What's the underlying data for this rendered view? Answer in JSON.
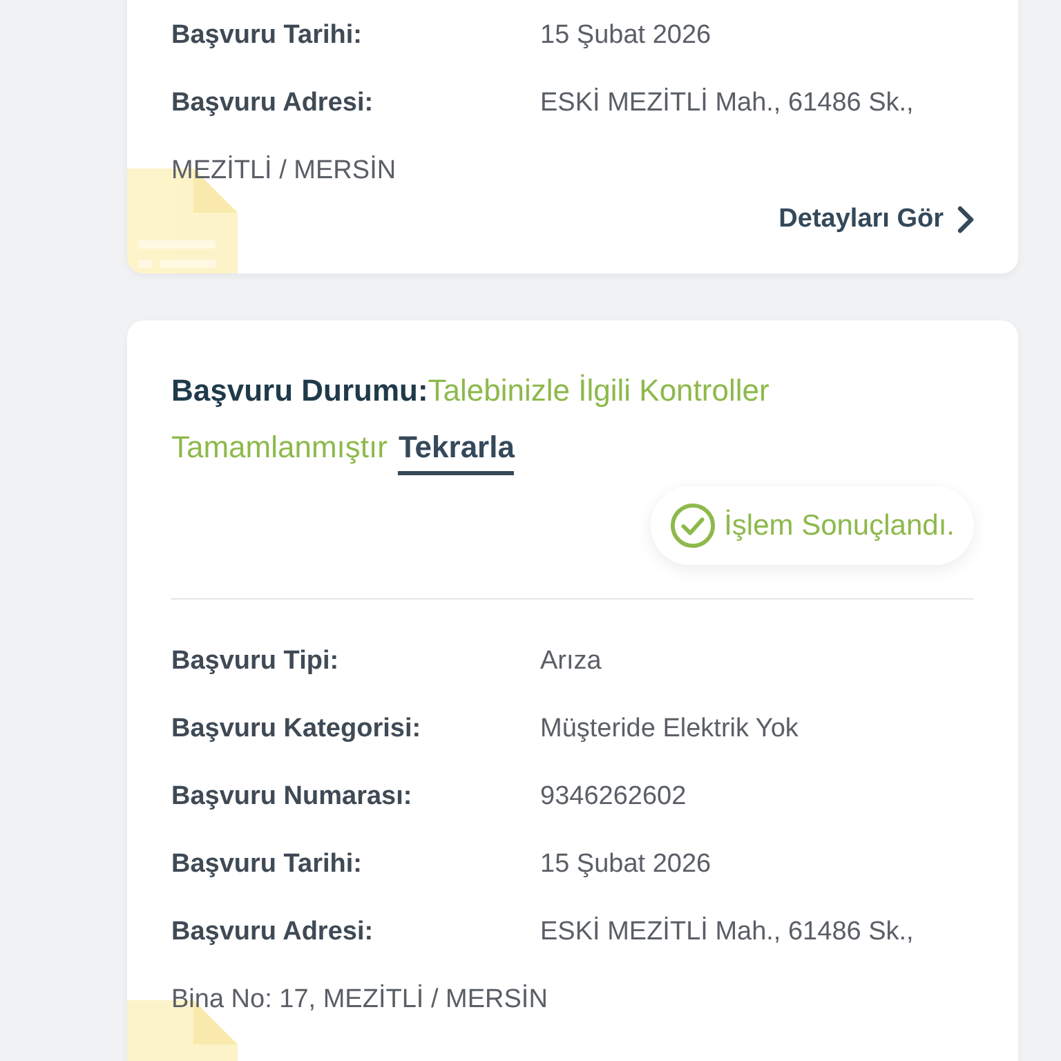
{
  "previous_application": {
    "fields": [
      {
        "label": "Başvuru Tarihi:",
        "value": "15 Şubat 2026"
      },
      {
        "label": "Başvuru Adresi:",
        "value": "ESKİ MEZİTLİ Mah., 61486 Sk.,",
        "continuation": "MEZİTLİ / MERSİN"
      }
    ],
    "details_link": "Detayları Gör"
  },
  "application": {
    "status_label": "Başvuru Durumu:",
    "status_text": "Talebinizle İlgili Kontroller Tamamlanmıştır",
    "repeat_link": "Tekrarla",
    "result_badge": "İşlem Sonuçlandı.",
    "fields": [
      {
        "label": "Başvuru Tipi:",
        "value": "Arıza"
      },
      {
        "label": "Başvuru Kategorisi:",
        "value": "Müşteride Elektrik Yok"
      },
      {
        "label": "Başvuru Numarası:",
        "value": "9346262602"
      },
      {
        "label": "Başvuru Tarihi:",
        "value": "15 Şubat 2026"
      },
      {
        "label": "Başvuru Adresi:",
        "value": "ESKİ MEZİTLİ Mah., 61486 Sk.,",
        "continuation": "Bina No: 17, MEZİTLİ / MERSİN"
      }
    ]
  }
}
